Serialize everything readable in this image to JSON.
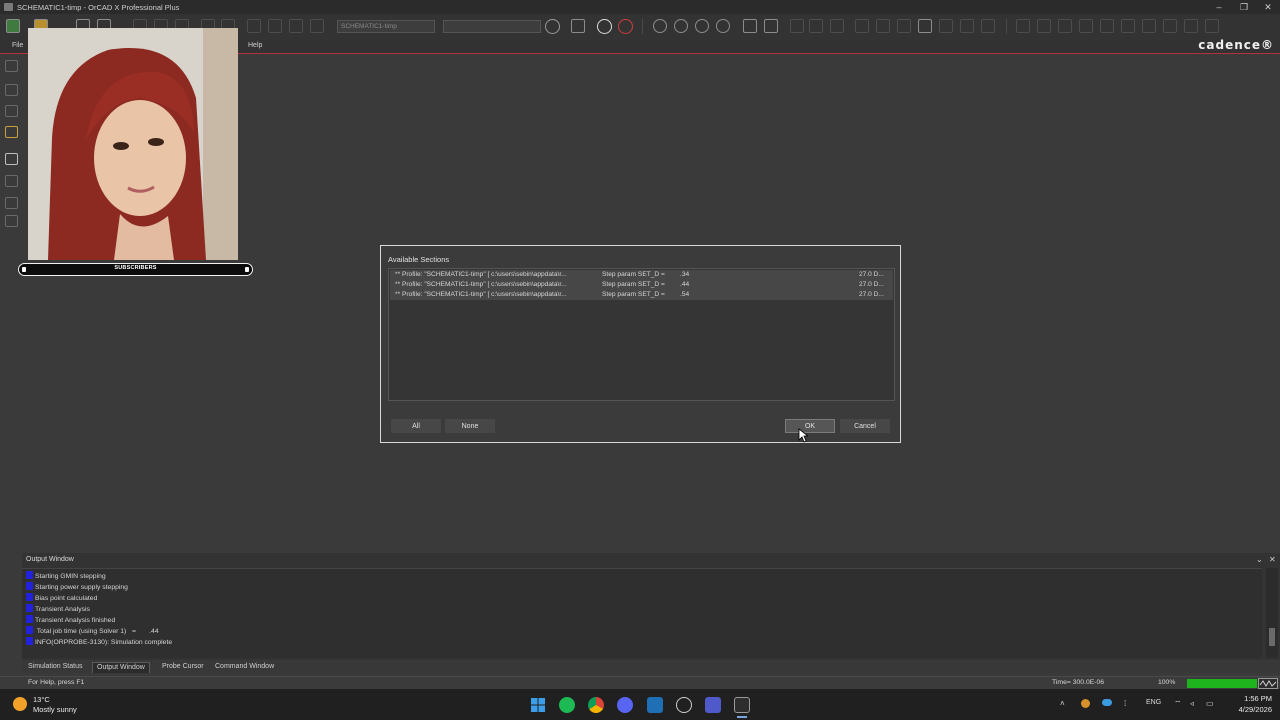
{
  "window": {
    "title": "SCHEMATIC1-timp - OrCAD X Professional Plus",
    "controls": {
      "minimize": "–",
      "restore": "❐",
      "close": "✕"
    }
  },
  "toolbar": {
    "profile_field": "SCHEMATIC1-timp",
    "icons": [
      "new-icon",
      "open-icon",
      "save-icon",
      "print-icon",
      "cut-icon",
      "copy-icon",
      "paste-icon",
      "undo-icon",
      "redo-icon",
      "run-icon",
      "pause-icon",
      "stop-icon",
      "zoom-in-icon",
      "zoom-out-icon",
      "zoom-fit-icon",
      "zoom-area-icon",
      "add-trace-icon",
      "fft-icon",
      "cursor-icon",
      "text-icon",
      "marker-icon"
    ]
  },
  "menu": {
    "file": "File",
    "help": "Help"
  },
  "brand": "cadence®",
  "webcam_overlay": {
    "banner": "SUBSCRIBERS"
  },
  "dialog": {
    "title": "Available Sections",
    "rows": [
      {
        "profile": "** Profile: \"SCHEMATIC1-timp\"  [ c:\\users\\sebin\\appdata\\r...",
        "step": "Step param SET_D =",
        "value": ".34",
        "temp": "27.0 D..."
      },
      {
        "profile": "** Profile: \"SCHEMATIC1-timp\"  [ c:\\users\\sebin\\appdata\\r...",
        "step": "Step param SET_D =",
        "value": ".44",
        "temp": "27.0 D..."
      },
      {
        "profile": "** Profile: \"SCHEMATIC1-timp\"  [ c:\\users\\sebin\\appdata\\r...",
        "step": "Step param SET_D =",
        "value": ".54",
        "temp": "27.0 D..."
      }
    ],
    "buttons": {
      "all": "All",
      "none": "None",
      "ok": "OK",
      "cancel": "Cancel"
    }
  },
  "output_window": {
    "title": "Output Window",
    "controls": {
      "dropdown": "⌄",
      "close": "✕"
    },
    "lines": [
      "Starting GMIN stepping",
      "Starting power supply stepping",
      "Bias point calculated",
      "Transient Analysis",
      "Transient Analysis finished",
      " Total job time (using Solver 1)   =       .44",
      "INFO(ORPROBE-3130): Simulation complete"
    ]
  },
  "tabs": [
    "Simulation Status",
    "Output Window",
    "Probe Cursor",
    "Command Window"
  ],
  "statusbar": {
    "help": "For Help, press F1",
    "time": "Time= 300.0E-06",
    "zoom": "100%",
    "progress": 1.0,
    "progress_color": "#1db41d"
  },
  "taskbar": {
    "weather_temp": "13°C",
    "weather_desc": "Mostly sunny",
    "apps": [
      "windows-start-icon",
      "spotify-icon",
      "chrome-icon",
      "discord-icon",
      "app-icon",
      "app-icon",
      "teams-icon",
      "orcad-icon"
    ],
    "language": "ENG",
    "time": "1:56 PM",
    "date": "4/29/2026"
  }
}
